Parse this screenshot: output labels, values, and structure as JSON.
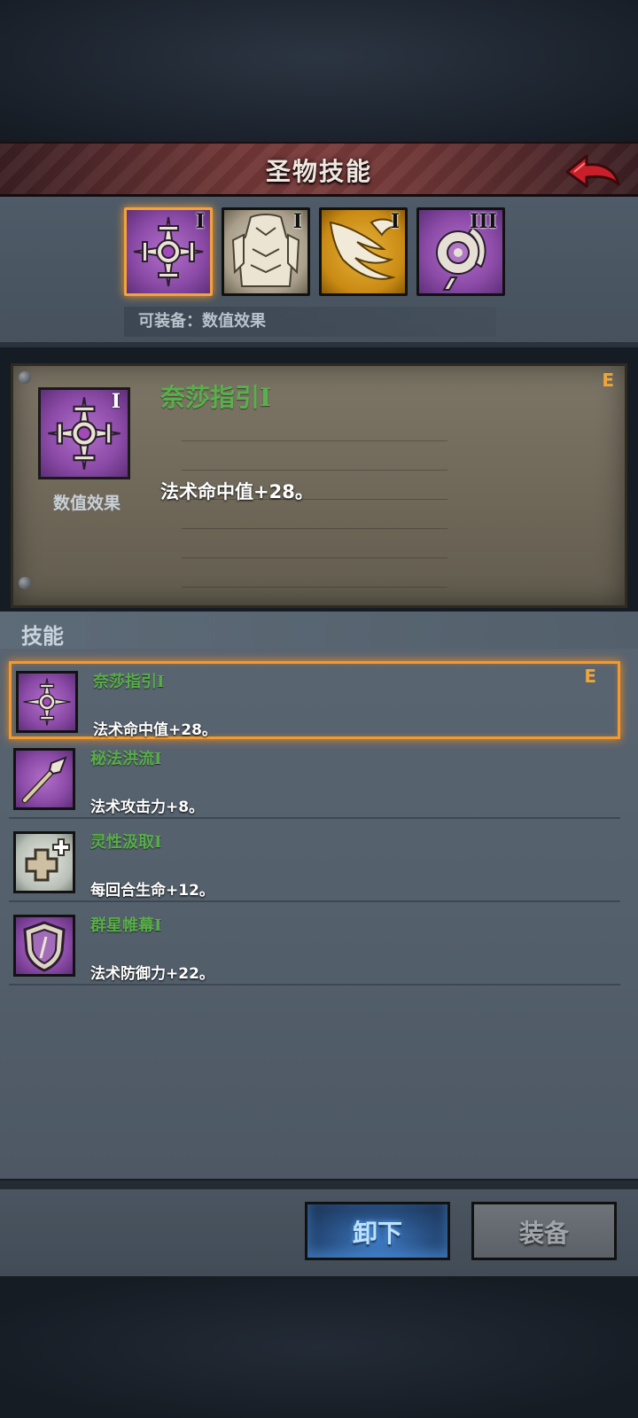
{
  "header": {
    "title": "圣物技能",
    "back_icon": "back-arrow-icon"
  },
  "relics": [
    {
      "tier": "I",
      "icon": "crosshair-star-icon",
      "color": "#8a4aa6",
      "selected": true
    },
    {
      "tier": "I",
      "icon": "bone-armor-icon",
      "color": "#a89e8a",
      "selected": false
    },
    {
      "tier": "I",
      "icon": "phoenix-wing-icon",
      "color": "#c98a14",
      "selected": false
    },
    {
      "tier": "III",
      "icon": "swirl-orb-icon",
      "color": "#8a4aa6",
      "selected": false
    }
  ],
  "equip_hint": "可装备：数值效果",
  "detail": {
    "name": "奈莎指引",
    "tier": "I",
    "grade": "E",
    "icon_label": "数值效果",
    "effect": "法术命中值+28。"
  },
  "skills_section": {
    "title": "技能",
    "items": [
      {
        "name": "奈莎指引",
        "tier": "I",
        "desc": "法术命中值+28。",
        "grade": "E",
        "icon": "crosshair-star-icon",
        "selected": true
      },
      {
        "name": "秘法洪流",
        "tier": "I",
        "desc": "法术攻击力+8。",
        "grade": "",
        "icon": "spear-icon",
        "selected": false
      },
      {
        "name": "灵性汲取",
        "tier": "I",
        "desc": "每回合生命+12。",
        "grade": "",
        "icon": "heal-cross-icon",
        "selected": false
      },
      {
        "name": "群星帷幕",
        "tier": "I",
        "desc": "法术防御力+22。",
        "grade": "",
        "icon": "shield-icon",
        "selected": false
      }
    ]
  },
  "buttons": {
    "unequip": "卸下",
    "equip": "装备"
  },
  "colors": {
    "accent_orange": "#f39a2a",
    "skill_name_green": "#58ad48",
    "unequip_blue": "#274d7e"
  }
}
